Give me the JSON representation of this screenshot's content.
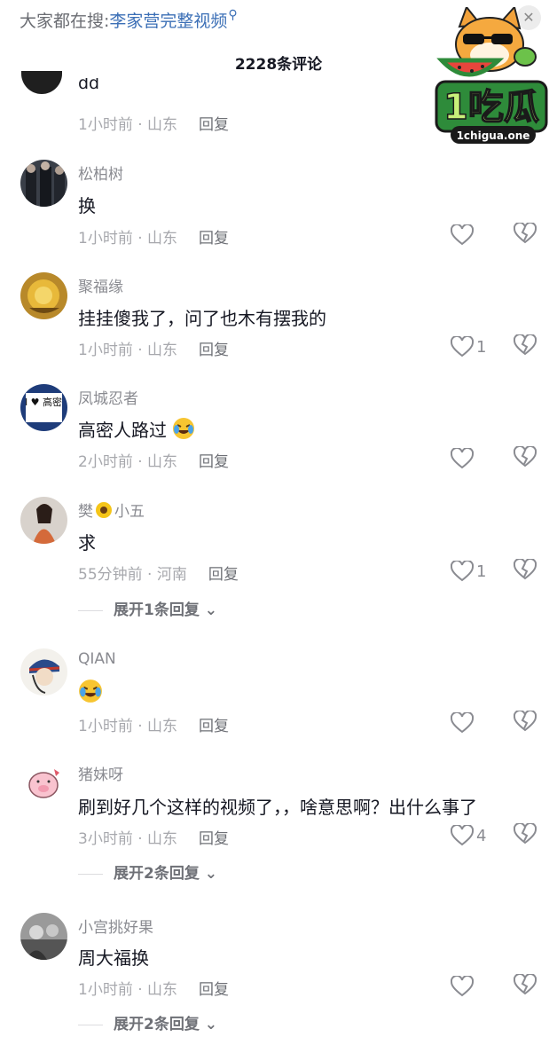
{
  "header": {
    "search_prefix": "大家都在搜:",
    "search_keyword": "李家营完整视频",
    "comment_count_title": "2228条评论"
  },
  "watermark": {
    "brand": "1吃瓜",
    "site": "1chigua.one"
  },
  "partial_comment": {
    "text": "dd",
    "meta": "1小时前 · 山东",
    "reply": "回复"
  },
  "comments": [
    {
      "username": "松柏树",
      "text": "换",
      "meta": "1小时前 · 山东",
      "reply": "回复",
      "likes": ""
    },
    {
      "username": "聚福缘",
      "text": "挂挂傻我了，问了也木有摆我的",
      "meta": "1小时前 · 山东",
      "reply": "回复",
      "likes": "1"
    },
    {
      "username": "凤城忍者",
      "text": "高密人路过",
      "meta": "2小时前 · 山东",
      "reply": "回复",
      "likes": "",
      "avatar_text": "I ♥ 高密"
    },
    {
      "username_a": "樊",
      "username_b": "小五",
      "text": "求",
      "meta": "55分钟前 · 河南",
      "reply": "回复",
      "likes": "1",
      "expand": "展开1条回复"
    },
    {
      "username": "QIAN",
      "text": "",
      "meta": "1小时前 · 山东",
      "reply": "回复",
      "likes": ""
    },
    {
      "username": "猪妹呀",
      "text": "刷到好几个这样的视频了，，啥意思啊？出什么事了",
      "meta": "3小时前 · 山东",
      "reply": "回复",
      "likes": "4",
      "expand": "展开2条回复"
    },
    {
      "username": "小宫挑好果",
      "text": "周大福换",
      "meta": "1小时前 · 山东",
      "reply": "回复",
      "likes": "",
      "expand": "展开2条回复"
    }
  ],
  "colors": {
    "link_blue": "#3b6fb6",
    "text_primary": "#161823",
    "text_secondary": "#8a8b91",
    "meta_gray": "#a7a8ad"
  }
}
